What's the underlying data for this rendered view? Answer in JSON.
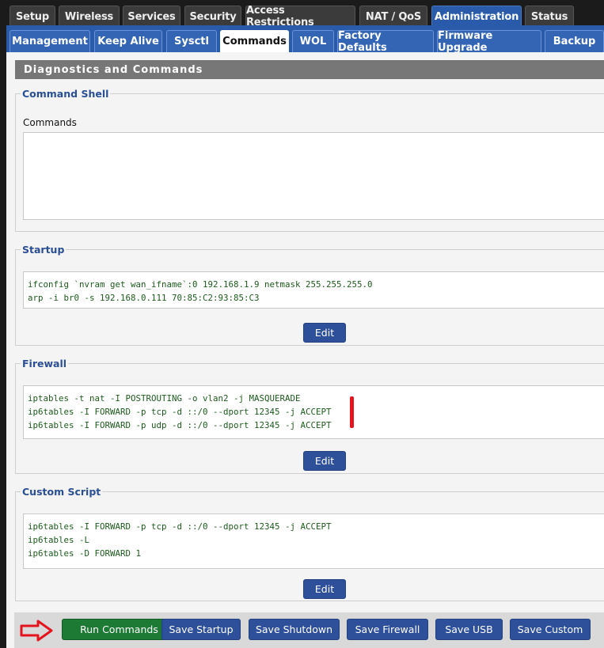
{
  "top_tabs": [
    "Setup",
    "Wireless",
    "Services",
    "Security",
    "Access Restrictions",
    "NAT / QoS",
    "Administration",
    "Status"
  ],
  "sub_tabs": [
    "Management",
    "Keep Alive",
    "Sysctl",
    "Commands",
    "WOL",
    "Factory Defaults",
    "Firmware Upgrade",
    "Backup"
  ],
  "page": {
    "header": "Diagnostics and Commands",
    "command_shell": {
      "legend": "Command Shell",
      "label": "Commands",
      "value": ""
    },
    "startup": {
      "legend": "Startup",
      "lines": [
        "ifconfig `nvram get wan_ifname`:0 192.168.1.9 netmask 255.255.255.0",
        "arp -i br0 -s 192.168.0.111 70:85:C2:93:85:C3"
      ],
      "edit_label": "Edit"
    },
    "firewall": {
      "legend": "Firewall",
      "lines": [
        "iptables -t nat -I POSTROUTING -o vlan2 -j MASQUERADE",
        "ip6tables -I FORWARD -p tcp -d ::/0 --dport 12345 -j ACCEPT",
        "ip6tables -I FORWARD -p udp -d ::/0 --dport 12345 -j ACCEPT"
      ],
      "edit_label": "Edit"
    },
    "custom_script": {
      "legend": "Custom Script",
      "lines": [
        "ip6tables -I FORWARD -p tcp -d ::/0 --dport 12345 -j ACCEPT",
        "ip6tables -L",
        "ip6tables -D FORWARD 1"
      ],
      "edit_label": "Edit"
    }
  },
  "footer_buttons": [
    "Run Commands",
    "Save Startup",
    "Save Shutdown",
    "Save Firewall",
    "Save USB",
    "Save Custom"
  ],
  "colors": {
    "active_tab": "#2a5bab",
    "button_blue": "#2e4f9a",
    "button_green": "#1d7a35",
    "annotation_red": "#e4141e"
  }
}
